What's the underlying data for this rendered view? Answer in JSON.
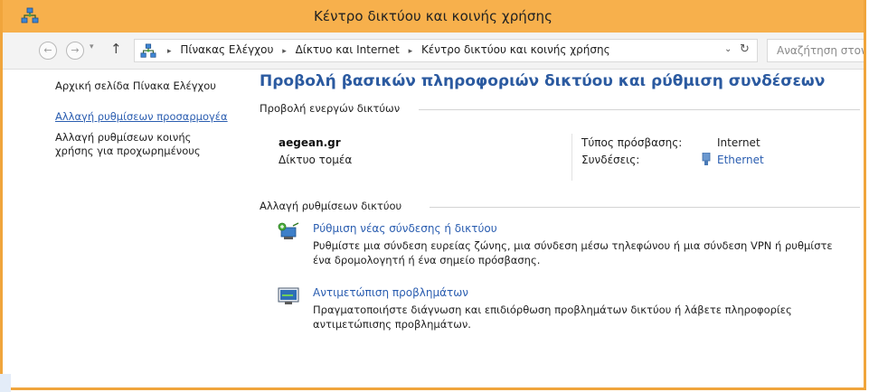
{
  "window": {
    "title": "Κέντρο δικτύου και κοινής χρήσης"
  },
  "addressbar": {
    "back_glyph": "←",
    "forward_glyph": "→",
    "history_glyph": "▾",
    "up_glyph": "↑",
    "breadcrumbs": [
      "Πίνακας Ελέγχου",
      "Δίκτυο και Internet",
      "Κέντρο δικτύου και κοινής χρήσης"
    ],
    "separator": "▸",
    "dropdown_glyph": "⌄",
    "refresh_glyph": "↻",
    "search_placeholder": "Αναζήτηση στον Π"
  },
  "sidebar": {
    "items": [
      {
        "label": "Αρχική σελίδα Πίνακα Ελέγχου",
        "link": false
      },
      {
        "label": "Αλλαγή ρυθμίσεων προσαρμογέα",
        "link": true
      },
      {
        "label": "Αλλαγή ρυθμίσεων κοινής χρήσης για προχωρημένους",
        "link": false
      }
    ]
  },
  "main": {
    "heading": "Προβολή βασικών πληροφοριών δικτύου και ρύθμιση συνδέσεων",
    "active_networks_label": "Προβολή ενεργών δικτύων",
    "network": {
      "name": "aegean.gr",
      "type": "Δίκτυο τομέα",
      "access_type_label": "Τύπος πρόσβασης:",
      "access_type_value": "Internet",
      "connections_label": "Συνδέσεις:",
      "connections_value": "Ethernet"
    },
    "change_settings_label": "Αλλαγή ρυθμίσεων δικτύου",
    "tasks": [
      {
        "link": "Ρύθμιση νέας σύνδεσης ή δικτύου",
        "description": "Ρυθμίστε μια σύνδεση ευρείας ζώνης, μια σύνδεση μέσω τηλεφώνου ή μια σύνδεση VPN ή ρυθμίστε ένα δρομολογητή ή ένα σημείο πρόσβασης."
      },
      {
        "link": "Αντιμετώπιση προβλημάτων",
        "description": "Πραγματοποιήστε διάγνωση και επιδιόρθωση προβλημάτων δικτύου ή λάβετε πληροφορίες αντιμετώπισης προβλημάτων."
      }
    ]
  },
  "colors": {
    "titlebar": "#f7b04c",
    "border": "#f0a53c",
    "link": "#2a5db0",
    "heading": "#2b5aa0"
  },
  "icons": {
    "app": "network-center-icon",
    "ethernet": "ethernet-icon",
    "task_new_connection": "new-connection-icon",
    "task_troubleshoot": "troubleshoot-icon"
  }
}
